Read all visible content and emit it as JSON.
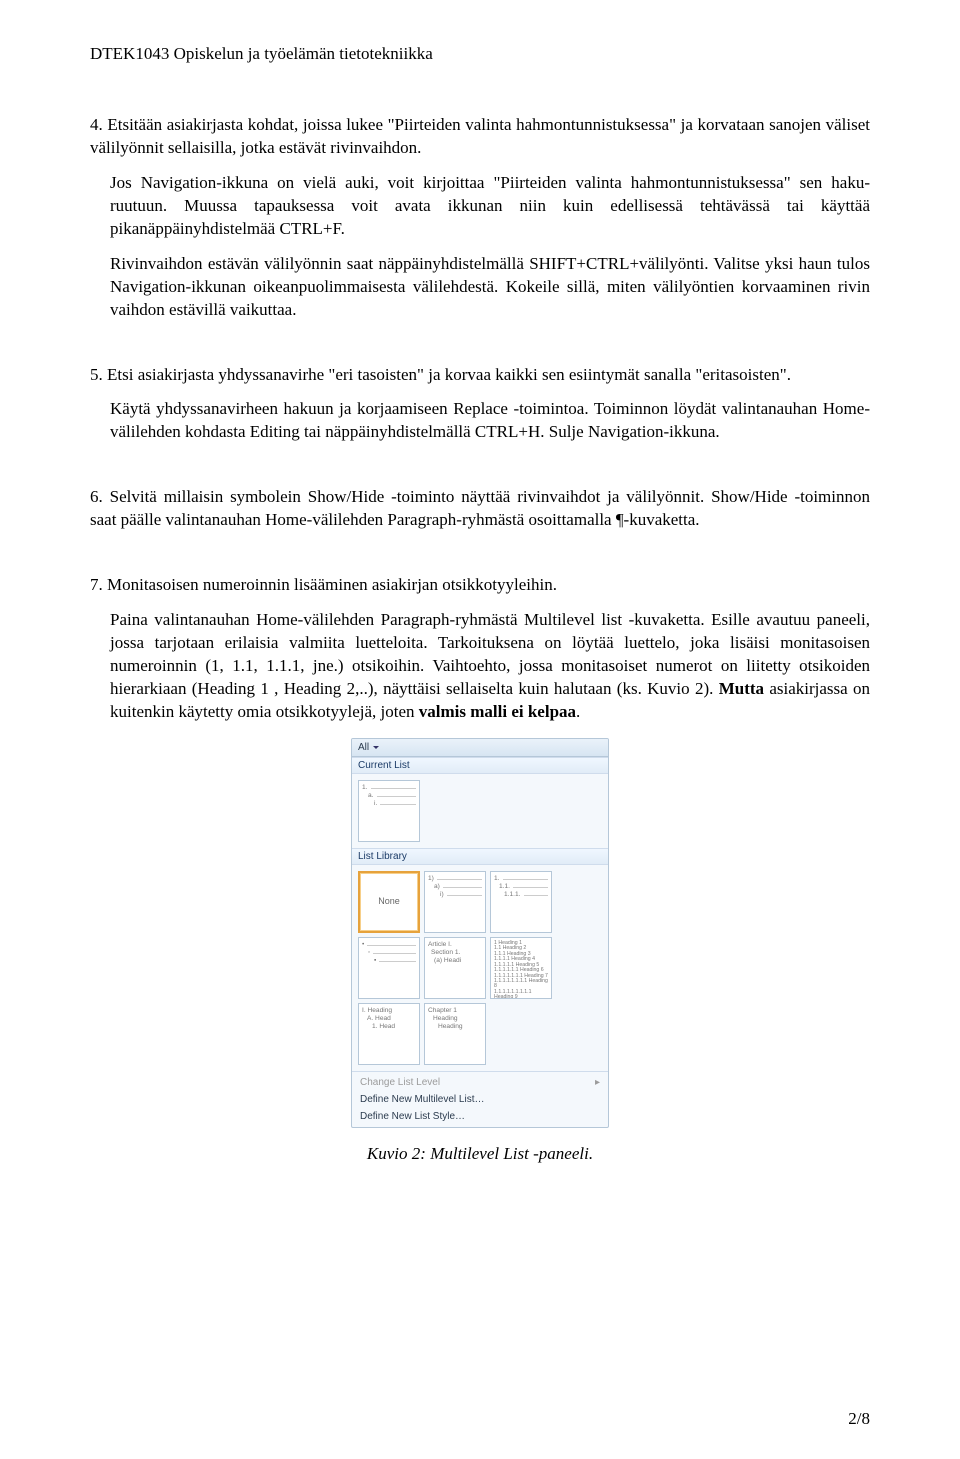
{
  "header": {
    "title": "DTEK1043 Opiskelun ja työelämän tietotekniikka"
  },
  "items": {
    "i4": {
      "num": "4.",
      "p1": "Etsitään asiakirjasta kohdat, joissa lukee \"Piirteiden valinta hahmontunnistuksessa\" ja korvataan sanojen väliset välilyönnit sellaisilla, jotka estävät rivinvaihdon.",
      "p2": "Jos Navigation-ikkuna on vielä auki, voit kirjoittaa \"Piirteiden valinta hahmontunnistuksessa\" sen haku-ruutuun. Muussa tapauksessa voit avata ikkunan niin kuin edellisessä tehtävässä tai käyttää pikanäppäinyhdistelmää CTRL+F.",
      "p3": "Rivinvaihdon estävän välilyönnin saat näppäinyhdistelmällä SHIFT+CTRL+välilyönti. Valitse yksi haun tulos Navigation-ikkunan oikeanpuolimmaisesta välilehdestä. Kokeile sillä, miten välilyöntien korvaaminen rivin vaihdon estävillä vaikuttaa."
    },
    "i5": {
      "num": "5.",
      "p1": "Etsi asiakirjasta yhdyssanavirhe \"eri tasoisten\" ja korvaa kaikki sen esiintymät sanalla \"eritasoisten\".",
      "p2": "Käytä yhdyssanavirheen hakuun ja korjaamiseen Replace -toimintoa. Toiminnon löydät valintanauhan Home-välilehden kohdasta Editing tai näppäinyhdistelmällä CTRL+H. Sulje Navigation-ikkuna."
    },
    "i6": {
      "num": "6.",
      "p1": "Selvitä millaisin symbolein Show/Hide -toiminto näyttää rivinvaihdot ja välilyönnit. Show/Hide -toiminnon saat päälle valintanauhan Home-välilehden Paragraph-ryhmästä osoittamalla ¶-kuvaketta."
    },
    "i7": {
      "num": "7.",
      "p1": "Monitasoisen numeroinnin lisääminen asiakirjan otsikkotyyleihin.",
      "p2a": "Paina valintanauhan Home-välilehden Paragraph-ryhmästä Multilevel list -kuvaketta. Esille avautuu paneeli, jossa tarjotaan erilaisia valmiita luetteloita. Tarkoituksena on löytää luettelo, joka lisäisi monitasoisen numeroinnin (1, 1.1, 1.1.1, jne.) otsikoihin. Vaihtoehto, jossa monitasoiset numerot on liitetty otsikoiden hierarkiaan (Heading 1 , Heading 2,..), näyttäisi sellaiselta kuin halutaan (ks. Kuvio 2). ",
      "p2b": "Mutta",
      "p2c": " asiakirjassa on kuitenkin käytetty omia otsikkotyylejä, joten ",
      "p2d": "valmis malli ei kelpaa",
      "p2e": "."
    }
  },
  "panel": {
    "all": "All",
    "dd": "▾",
    "section_current": "Current List",
    "section_library": "List Library",
    "cells": {
      "current1": {
        "l1": "1.",
        "l2": "a.",
        "l3": "i."
      },
      "none": "None",
      "opt2": {
        "l1": "1)",
        "l2": "a)",
        "l3": "i)"
      },
      "opt3": {
        "l1": "1.",
        "l2": "1.1.",
        "l3": "1.1.1."
      },
      "opt4": {
        "l1": "•",
        "l2": "◦",
        "l3": "▪"
      },
      "opt5": {
        "l1": "Article I.",
        "l2": "Section 1.",
        "l3": "(a) Headi"
      },
      "opt6": {
        "lines": [
          "1 Heading 1",
          "1.1 Heading 2",
          "1.1.1 Heading 3",
          "1.1.1.1 Heading 4",
          "1.1.1.1.1 Heading 5",
          "1.1.1.1.1.1 Heading 6",
          "1.1.1.1.1.1.1 Heading 7",
          "1.1.1.1.1.1.1.1 Heading 8",
          "1.1.1.1.1.1.1.1.1 Heading 9"
        ]
      },
      "opt7": {
        "l1": "I. Heading",
        "l2": "A. Head",
        "l3": "1. Head"
      },
      "opt8": {
        "l1": "Chapter 1",
        "l2": "Heading",
        "l3": "Heading"
      }
    },
    "menu": {
      "change": "Change List Level",
      "define_ml": "Define New Multilevel List…",
      "define_style": "Define New List Style…"
    }
  },
  "caption": "Kuvio 2: Multilevel List -paneeli.",
  "pagenum": "2/8"
}
